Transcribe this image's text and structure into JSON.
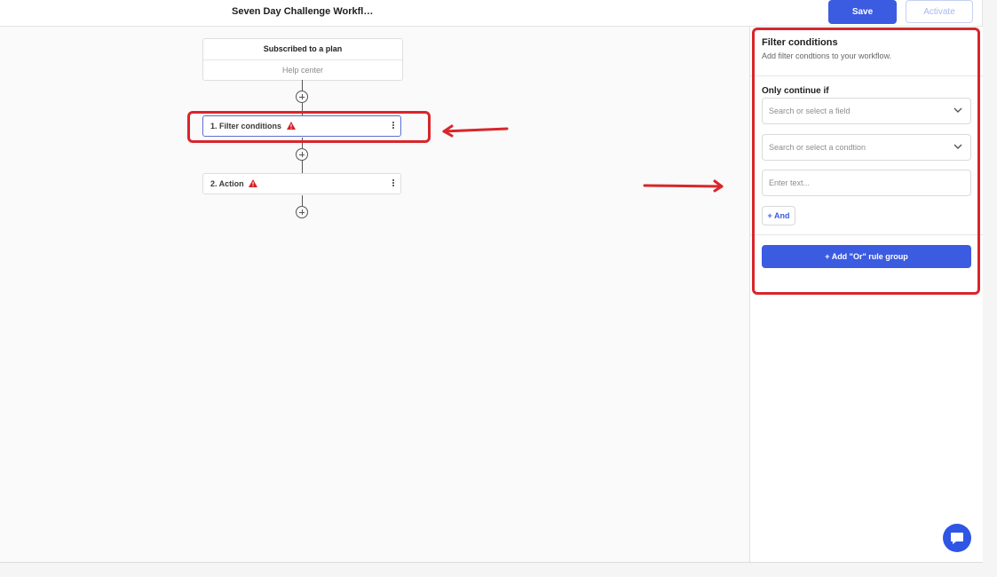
{
  "header": {
    "workflow_title": "Seven Day Challenge Workfl…",
    "save_label": "Save",
    "activate_label": "Activate"
  },
  "canvas": {
    "trigger": {
      "title": "Subscribed to a plan",
      "subtitle": "Help center"
    },
    "steps": [
      {
        "label": "1. Filter conditions",
        "status": "warning",
        "selected": true
      },
      {
        "label": "2. Action",
        "status": "warning",
        "selected": false
      }
    ]
  },
  "panel": {
    "title": "Filter conditions",
    "subtitle": "Add filter condtions to your workflow.",
    "only_continue_label": "Only continue if",
    "field_select_placeholder": "Search or select a field",
    "condition_select_placeholder": "Search or select a condtion",
    "text_input_placeholder": "Enter text...",
    "and_button_label": "+ And",
    "or_group_button_label": "+ Add \"Or\" rule group"
  },
  "colors": {
    "accent": "#3b5be0",
    "warning": "#d81f26",
    "annotation": "#d8262b"
  }
}
